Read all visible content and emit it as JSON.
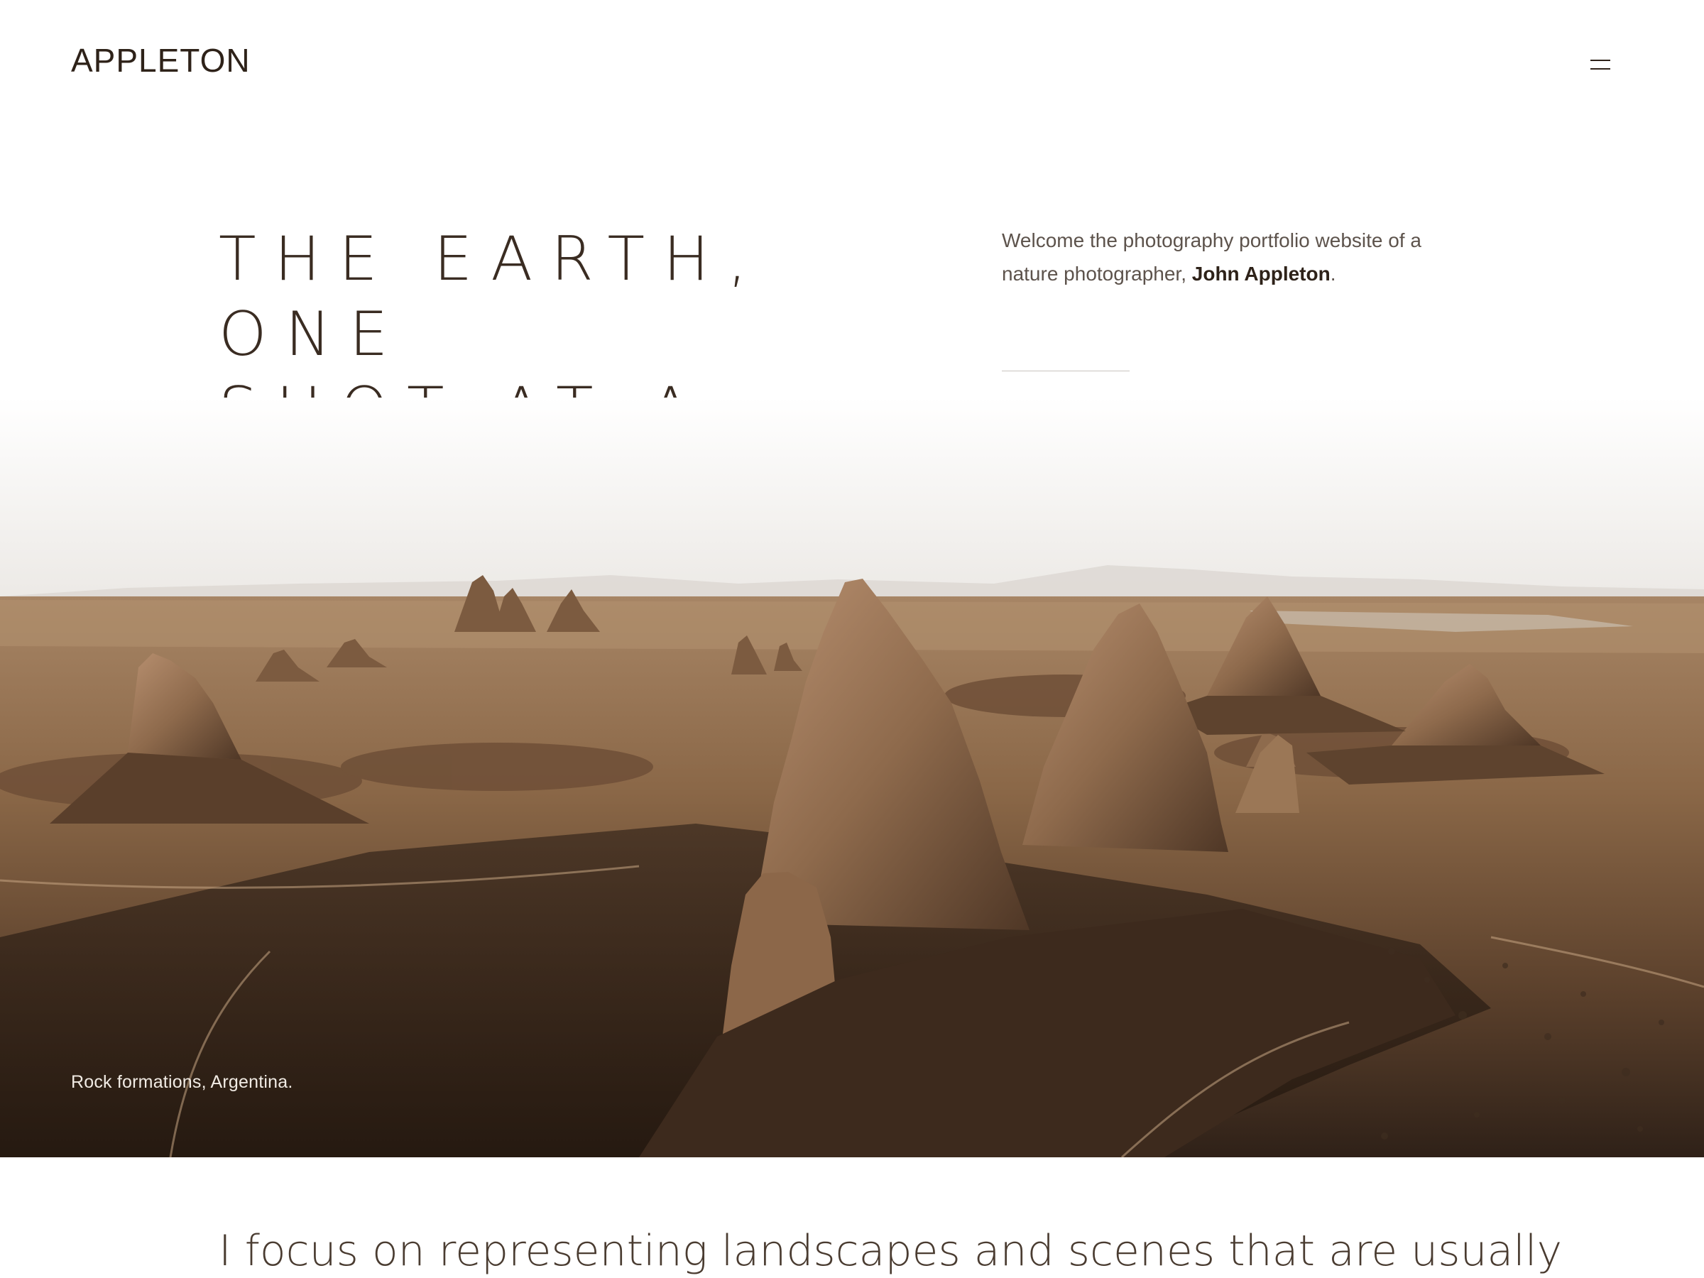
{
  "header": {
    "logo_text": "APPLETON",
    "menu_icon": "hamburger-menu-icon"
  },
  "hero": {
    "headline_line1": "THE EARTH, ONE",
    "headline_line2": "SHOT AT A TIME.",
    "intro_text_before": "Welcome the photography portfolio website of a nature photographer, ",
    "intro_name": "John Appleton",
    "intro_text_after": ".",
    "image_caption": "Rock formations, Argentina."
  },
  "about": {
    "focus_text": "I focus on representing landscapes and scenes that are usually"
  },
  "colors": {
    "text_primary": "#2e2219",
    "text_secondary": "#5d534c",
    "background": "#ffffff",
    "desert_light": "#b08a62",
    "desert_dark": "#3a281c"
  }
}
